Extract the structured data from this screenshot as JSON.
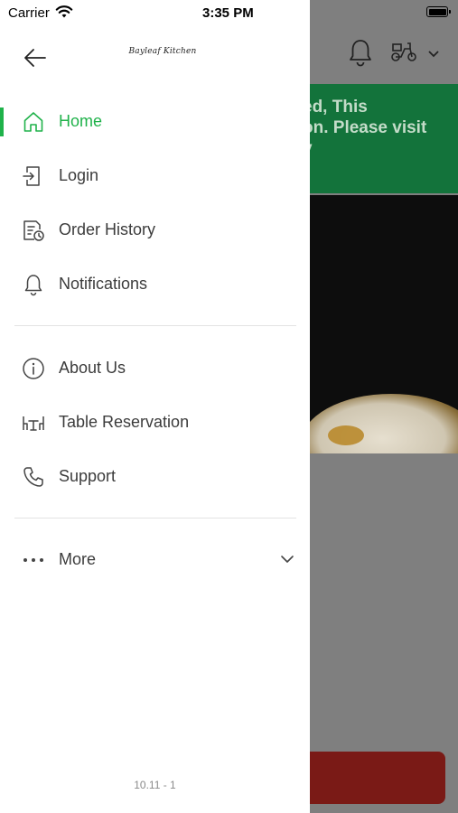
{
  "status_bar": {
    "carrier": "Carrier",
    "time": "3:35 PM"
  },
  "drawer": {
    "brand_name": "Bayleaf Kitchen",
    "menu_primary": [
      {
        "label": "Home",
        "icon": "home-icon",
        "active": true
      },
      {
        "label": "Login",
        "icon": "login-icon",
        "active": false
      },
      {
        "label": "Order History",
        "icon": "order-history-icon",
        "active": false
      },
      {
        "label": "Notifications",
        "icon": "bell-icon",
        "active": false
      }
    ],
    "menu_secondary": [
      {
        "label": "About Us",
        "icon": "info-icon"
      },
      {
        "label": "Table Reservation",
        "icon": "table-reservation-icon"
      },
      {
        "label": "Support",
        "icon": "phone-icon"
      }
    ],
    "more": {
      "label": "More",
      "icon": "more-dots-icon"
    },
    "version": "10.11 - 1"
  },
  "background_app": {
    "notice_lines": [
      "ed, This",
      "on. Please visit",
      "y"
    ],
    "banner_color": "#13733b",
    "cta_color": "#7a1a16"
  },
  "colors": {
    "accent": "#1fb24a",
    "text": "#3c3c3c",
    "scrim": "#7f7f7f"
  }
}
